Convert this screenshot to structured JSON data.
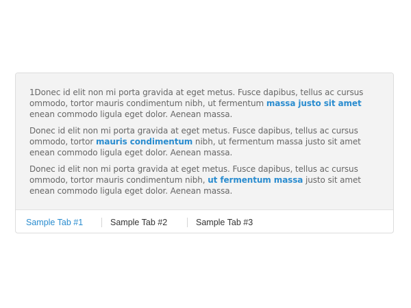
{
  "panel": {
    "paragraphs": [
      {
        "before": "1Donec id elit non mi porta gravida at eget metus. Fusce dapibus, tellus ac cursus ommodo, tortor mauris condimentum nibh, ut fermentum ",
        "highlight": "massa justo sit amet",
        "after": " enean commodo ligula eget dolor. Aenean massa."
      },
      {
        "before": "Donec id elit non mi porta gravida at eget metus. Fusce dapibus, tellus ac cursus ommodo, tortor ",
        "highlight": "mauris condimentum",
        "after": " nibh, ut fermentum massa justo sit amet enean commodo ligula eget dolor. Aenean massa."
      },
      {
        "before": "Donec id elit non mi porta gravida at eget metus. Fusce dapibus, tellus ac cursus ommodo, tortor mauris condimentum nibh, ",
        "highlight": "ut fermentum massa",
        "after": " justo sit amet enean commodo ligula eget dolor. Aenean massa."
      }
    ]
  },
  "tabs": [
    {
      "label": "Sample Tab #1",
      "active": true
    },
    {
      "label": "Sample Tab #2",
      "active": false
    },
    {
      "label": "Sample Tab #3",
      "active": false
    }
  ],
  "colors": {
    "accent": "#2a8ccf",
    "text": "#666666",
    "panel_bg": "#f3f3f3",
    "border": "#dcdcdc"
  }
}
